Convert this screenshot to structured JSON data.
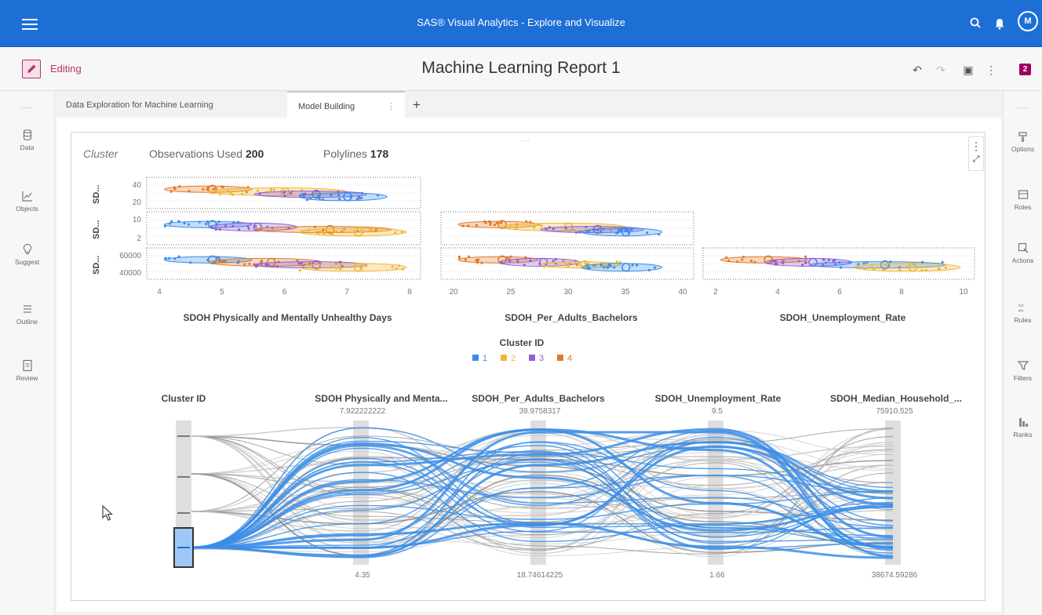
{
  "app": {
    "title": "SAS® Visual Analytics - Explore and Visualize",
    "user_initial": "M"
  },
  "editbar": {
    "mode_label": "Editing",
    "report_title": "Machine Learning Report 1",
    "badge": "2"
  },
  "left_rail": {
    "dots": "....",
    "items": [
      {
        "label": "Data",
        "icon": "database-icon"
      },
      {
        "label": "Objects",
        "icon": "chart-line-icon"
      },
      {
        "label": "Suggest",
        "icon": "lightbulb-icon"
      },
      {
        "label": "Outline",
        "icon": "list-icon"
      },
      {
        "label": "Review",
        "icon": "document-icon"
      }
    ]
  },
  "right_rail": {
    "dots": "....",
    "items": [
      {
        "label": "Options",
        "icon": "paint-icon"
      },
      {
        "label": "Roles",
        "icon": "roles-icon"
      },
      {
        "label": "Actions",
        "icon": "actions-icon"
      },
      {
        "label": "Rules",
        "icon": "rules-icon"
      },
      {
        "label": "Filters",
        "icon": "filter-icon"
      },
      {
        "label": "Ranks",
        "icon": "ranks-icon"
      }
    ]
  },
  "tabs": [
    {
      "label": "Data Exploration for Machine Learning"
    },
    {
      "label": "Model Building"
    }
  ],
  "tab_add": "+",
  "header": {
    "cluster_label": "Cluster",
    "obs_label": "Observations Used",
    "obs_value": "200",
    "poly_label": "Polylines",
    "poly_value": "178"
  },
  "colors": {
    "cluster1": "#3b8ee8",
    "cluster2": "#f0b732",
    "cluster3": "#8e5fd6",
    "cluster4": "#e07a2a",
    "accent": "#1d6fd6"
  },
  "chart_data": [
    {
      "type": "scatter",
      "title": "",
      "row_labels": [
        "SD...",
        "SD...",
        "SD..."
      ],
      "x_axes": [
        {
          "label": "SDOH Physically and Mentally Unhealthy Days",
          "ticks": [
            "4",
            "5",
            "6",
            "7",
            "8"
          ],
          "range": [
            4,
            8
          ]
        },
        {
          "label": "SDOH_Per_Adults_Bachelors",
          "ticks": [
            "20",
            "25",
            "30",
            "35",
            "40"
          ],
          "range": [
            18.7,
            40
          ]
        },
        {
          "label": "SDOH_Unemployment_Rate",
          "ticks": [
            "2",
            "4",
            "6",
            "8",
            "10"
          ],
          "range": [
            1.66,
            10
          ]
        }
      ],
      "y_axes": [
        {
          "ticks": [
            "40",
            "20"
          ]
        },
        {
          "ticks": [
            "10",
            "2"
          ]
        },
        {
          "ticks": [
            "60000",
            "40000"
          ]
        }
      ],
      "legend_title": "Cluster ID",
      "legend": [
        "1",
        "2",
        "3",
        "4"
      ],
      "legend_placement": "bottom"
    },
    {
      "type": "parallel_coordinates",
      "axes": [
        {
          "label": "Cluster ID",
          "max": "",
          "min": ""
        },
        {
          "label": "SDOH Physically and Menta...",
          "max": "7.922222222",
          "min": "4.35"
        },
        {
          "label": "SDOH_Per_Adults_Bachelors",
          "max": "39.9758317",
          "min": "18.74614225"
        },
        {
          "label": "SDOH_Unemployment_Rate",
          "max": "9.5",
          "min": "1.66"
        },
        {
          "label": "SDOH_Median_Household_...",
          "max": "75910.525",
          "min": "38674.59286"
        }
      ],
      "selected_cluster": "1"
    }
  ]
}
